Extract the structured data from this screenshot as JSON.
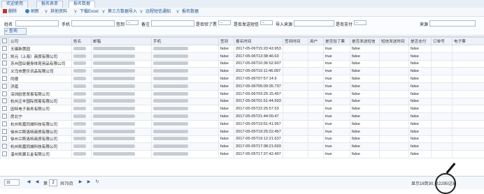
{
  "tabs": [
    "欢迎使用",
    "报名表单",
    "报名数据"
  ],
  "toolbar": {
    "buttons": [
      "删除",
      "刷新",
      "其他资料",
      "下载Excel",
      "第三方数据导入",
      "远程短信通知",
      "报名数据"
    ]
  },
  "filters": {
    "name_label": "姓名",
    "phone_label": "手机",
    "signed_label": "签到",
    "signed_value": "--",
    "remark_label": "备注",
    "paid_filter_label": "是否验了票",
    "paid_filter_value": "--",
    "sms_label": "是否发送短信",
    "sms_value": "--",
    "import_label": "导入来源",
    "pay_label": "是否支付",
    "pay_value": "--",
    "source_label": "来源",
    "query_button": "查询"
  },
  "table": {
    "headers": [
      "公司",
      "姓名",
      "邮箱",
      "手机",
      "签到",
      "报名时间",
      "签到时间",
      "用户",
      "是否验了票",
      "是否发送短信",
      "短信发送时间",
      "是否支付",
      "订单号",
      "电子票"
    ],
    "rows": [
      [
        "无锡新惠园",
        "false",
        "2017-05-06T15:20:43.953",
        "false",
        "true",
        "false",
        "false"
      ],
      [
        "凯元（上海）商贸有限公司",
        "false",
        "2017-05-06T13:38:46.63",
        "false",
        "true",
        "false",
        "false"
      ],
      [
        "苏州固业健身体育用品有限公司",
        "false",
        "2017-05-06T10:36:52.607",
        "false",
        "true",
        "false",
        "false"
      ],
      [
        "义乌市楚乐讯品有限公司",
        "false",
        "2017-05-06T10:11:46.097",
        "false",
        "true",
        "false",
        "false"
      ],
      [
        "同德",
        "false",
        "2017-05-06T07:57:14.9",
        "false",
        "true",
        "false",
        "false"
      ],
      [
        "济南",
        "false",
        "2017-05-06T05:09:35.737",
        "false",
        "true",
        "false",
        "false"
      ],
      [
        "深圳欧意贸易有限公司",
        "false",
        "2017-05-06T03:25:15.457",
        "false",
        "true",
        "false",
        "false"
      ],
      [
        "杭州正丰国际贸易有限公司",
        "false",
        "2017-05-06T01:51:44.593",
        "false",
        "true",
        "false",
        "false"
      ],
      [
        "因特电子商务有限公司",
        "false",
        "2017-05-05T22:25:57.53",
        "false",
        "true",
        "false",
        "false"
      ],
      [
        "房北宁",
        "false",
        "2017-05-05T21:44:09.47",
        "false",
        "true",
        "false",
        "false"
      ],
      [
        "杭州凯嘉同城科技有限公司",
        "false",
        "2017-05-05T19:51:41.957",
        "false",
        "true",
        "false",
        "false"
      ],
      [
        "徐州兰斯洛特商贸有限公司",
        "false",
        "2017-05-05T19:25:22.457",
        "false",
        "true",
        "false",
        "false"
      ],
      [
        "徐州兰斯洛特商贸有限公司",
        "false",
        "2017-05-05T19:12:21.637",
        "false",
        "true",
        "false",
        "false"
      ],
      [
        "杭州凯嘉同城科技有限公司",
        "false",
        "2017-05-05T17:38:21.693",
        "false",
        "true",
        "false",
        "false"
      ],
      [
        "温州凯翼五金有限公司",
        "false",
        "2017-05-05T17:37:42.497",
        "false",
        "true",
        "false",
        "false"
      ]
    ]
  },
  "footer": {
    "page_size": "15",
    "page_prefix": "第",
    "page_value": "2",
    "page_suffix": "共75页",
    "summary": "显示16到30,共2295记录"
  },
  "colors": {
    "accent": "#215a9e",
    "header_bg": "#eef2f8"
  }
}
